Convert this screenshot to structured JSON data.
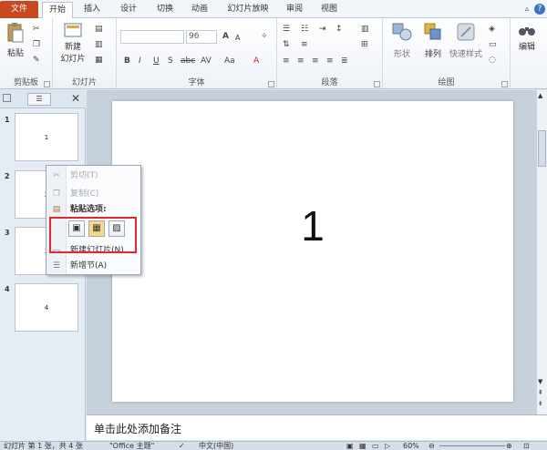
{
  "tabs": [
    {
      "label": "文件"
    },
    {
      "label": "开始"
    },
    {
      "label": "插入"
    },
    {
      "label": "设计"
    },
    {
      "label": "切换"
    },
    {
      "label": "动画"
    },
    {
      "label": "幻灯片放映"
    },
    {
      "label": "审阅"
    },
    {
      "label": "视图"
    }
  ],
  "ribbon": {
    "clipboard": {
      "paste_label": "粘贴",
      "group_label": "剪贴板"
    },
    "slides": {
      "new_slide_label_1": "新建",
      "new_slide_label_2": "幻灯片",
      "group_label": "幻灯片"
    },
    "font": {
      "size_value": "96",
      "group_label": "字体",
      "bold": "B",
      "italic": "I",
      "underline": "U",
      "strike": "S",
      "abc": "abc",
      "spacing": "AV",
      "case": "Aa",
      "grow": "A",
      "shrink": "A",
      "color": "A"
    },
    "paragraph": {
      "group_label": "段落"
    },
    "drawing": {
      "shapes_label": "形状",
      "arrange_label": "排列",
      "quick_styles_label": "快速样式",
      "group_label": "绘图"
    },
    "editing": {
      "label": "编辑"
    }
  },
  "slides": [
    {
      "num": "1",
      "text": "1"
    },
    {
      "num": "2",
      "text": "2"
    },
    {
      "num": "3",
      "text": "3"
    },
    {
      "num": "4",
      "text": "4"
    }
  ],
  "context_menu": {
    "cut": "剪切(T)",
    "copy": "复制(C)",
    "paste_options": "粘贴选项:",
    "new_slide": "新建幻灯片(N)",
    "new_section": "新增节(A)"
  },
  "main_slide_text": "1",
  "notes_placeholder": "单击此处添加备注",
  "status": {
    "slide_info": "幻灯片 第 1 张，共 4 张",
    "theme": "\"Office 主题\"",
    "language": "中文(中国)",
    "zoom": "60%"
  },
  "colors": {
    "file_tab": "#c9481f",
    "highlight": "#e0282e"
  }
}
